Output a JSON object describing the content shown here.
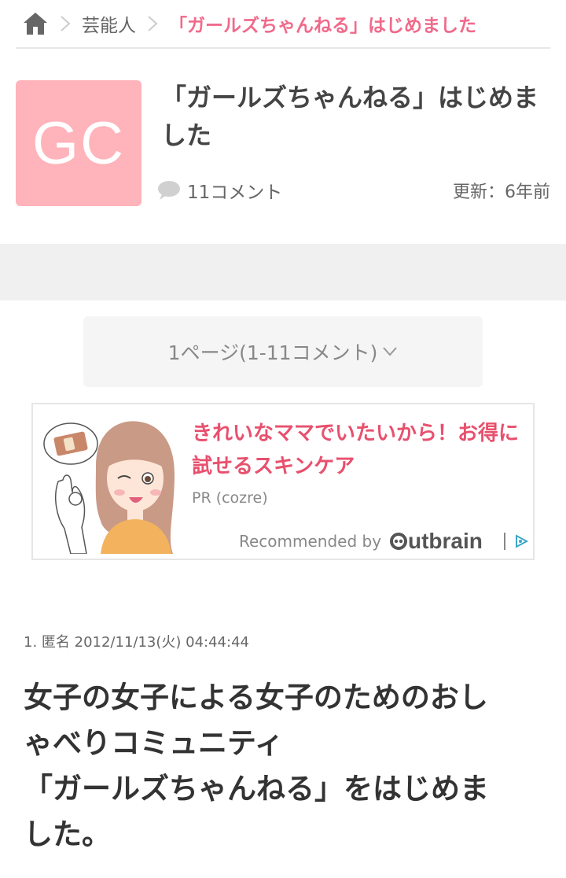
{
  "breadcrumb": {
    "category": "芸能人",
    "current": "「ガールズちゃんねる」はじめました"
  },
  "article": {
    "thumb_text": "GC",
    "title": "「ガールズちゃんねる」はじめました",
    "comment_count": "11コメント",
    "updated": "更新：6年前"
  },
  "pager": {
    "label": "1ページ(1-11コメント)"
  },
  "ad": {
    "title": "きれいなママでいたいから！お得に試せるスキンケア",
    "sponsor": "PR (cozre)",
    "recommended_by": "Recommended by",
    "brand": "Outbrain"
  },
  "comment": {
    "header": "1. 匿名 2012/11/13(火) 04:44:44",
    "lines": [
      "女子の女子による女子のためのおし",
      "ゃべりコミュニティ",
      "「ガールズちゃんねる」をはじめま",
      "した。"
    ]
  },
  "colors": {
    "accent": "#f06a8a",
    "thumb_bg": "#ffb3ba",
    "ad_title": "#e8506e"
  }
}
